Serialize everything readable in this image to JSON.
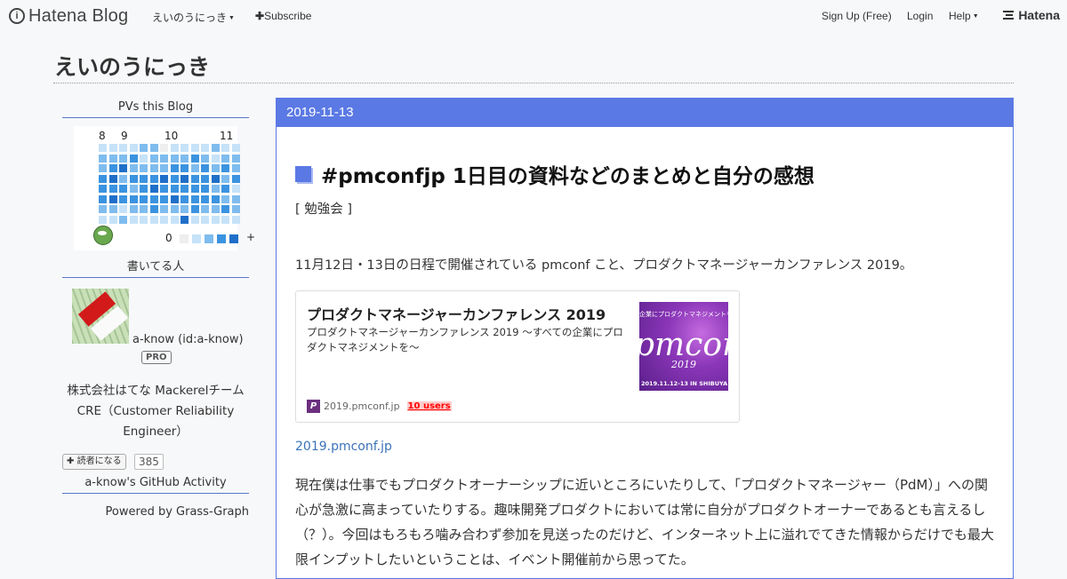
{
  "topbar": {
    "logo_text": "Hatena Blog",
    "blog_menu": "えいのうにっき",
    "subscribe": "Subscribe",
    "signup": "Sign Up (Free)",
    "login": "Login",
    "help": "Help",
    "hatena": "Hatena"
  },
  "blog": {
    "title": "えいのうにっき"
  },
  "sidebar": {
    "pv_title": "PVs this Blog",
    "pv_months": [
      "8",
      "9",
      "10",
      "11"
    ],
    "pv_legend_min": "0",
    "pv_legend_max": "+",
    "pv_colors": [
      "#eeeeee",
      "#c6e2f8",
      "#7fbcee",
      "#3b93e0",
      "#1f6fc9"
    ],
    "pv_levels": [
      [
        1,
        1,
        1,
        1,
        2,
        2,
        0,
        1,
        1,
        1,
        1,
        2,
        1,
        1
      ],
      [
        2,
        2,
        2,
        3,
        1,
        2,
        2,
        2,
        2,
        3,
        2,
        1,
        2,
        2
      ],
      [
        2,
        3,
        4,
        2,
        2,
        2,
        2,
        3,
        3,
        2,
        3,
        2,
        3,
        2
      ],
      [
        3,
        4,
        2,
        3,
        3,
        3,
        4,
        3,
        4,
        3,
        3,
        4,
        2,
        3
      ],
      [
        3,
        3,
        3,
        2,
        3,
        4,
        3,
        3,
        3,
        3,
        3,
        2,
        3,
        1
      ],
      [
        3,
        4,
        3,
        3,
        3,
        3,
        3,
        4,
        3,
        3,
        3,
        3,
        2,
        2
      ],
      [
        2,
        2,
        1,
        2,
        2,
        3,
        2,
        2,
        2,
        3,
        2,
        2,
        3,
        2
      ],
      [
        1,
        1,
        2,
        1,
        1,
        1,
        1,
        1,
        4,
        1,
        1,
        1,
        1,
        1
      ]
    ],
    "author_title": "書いてる人",
    "author_name": "a-know (id:a-know)",
    "pro": "PRO",
    "description": "株式会社はてな Mackerelチーム CRE（Customer Reliability Engineer）",
    "reader_button": "読者になる",
    "reader_count": "385",
    "github_title": "a-know's GitHub Activity",
    "powered": "Powered by Grass-Graph"
  },
  "entry": {
    "date": "2019-11-13",
    "title": "#pmconfjp 1日目の資料などのまとめと自分の感想",
    "category": "[ 勉強会 ]",
    "intro": "11月12日・13日の日程で開催されている pmconf こと、プロダクトマネージャーカンファレンス 2019。",
    "card": {
      "title": "プロダクトマネージャーカンファレンス 2019",
      "description": "プロダクトマネージャーカンファレンス 2019 〜すべての企業にプロダクトマネジメントを〜",
      "thumb_top": "企業にプロダクトマネジメントを",
      "thumb_word": "pmconf",
      "thumb_year": "2019",
      "thumb_date": "2019.11.12-13 IN SHIBUYA",
      "domain": "2019.pmconf.jp",
      "users": "10 users"
    },
    "link": "2019.pmconf.jp",
    "body": "現在僕は仕事でもプロダクトオーナーシップに近いところにいたりして、「プロダクトマネージャー（PdM）」への関心が急激に高まっていたりする。趣味開発プロダクトにおいては常に自分がプロダクトオーナーであるとも言えるし（？）。今回はもろもろ噛み合わず参加を見送ったのだけど、インターネット上に溢れでてきた情報からだけでも最大限インプットしたいということは、イベント開催前から思ってた。"
  }
}
